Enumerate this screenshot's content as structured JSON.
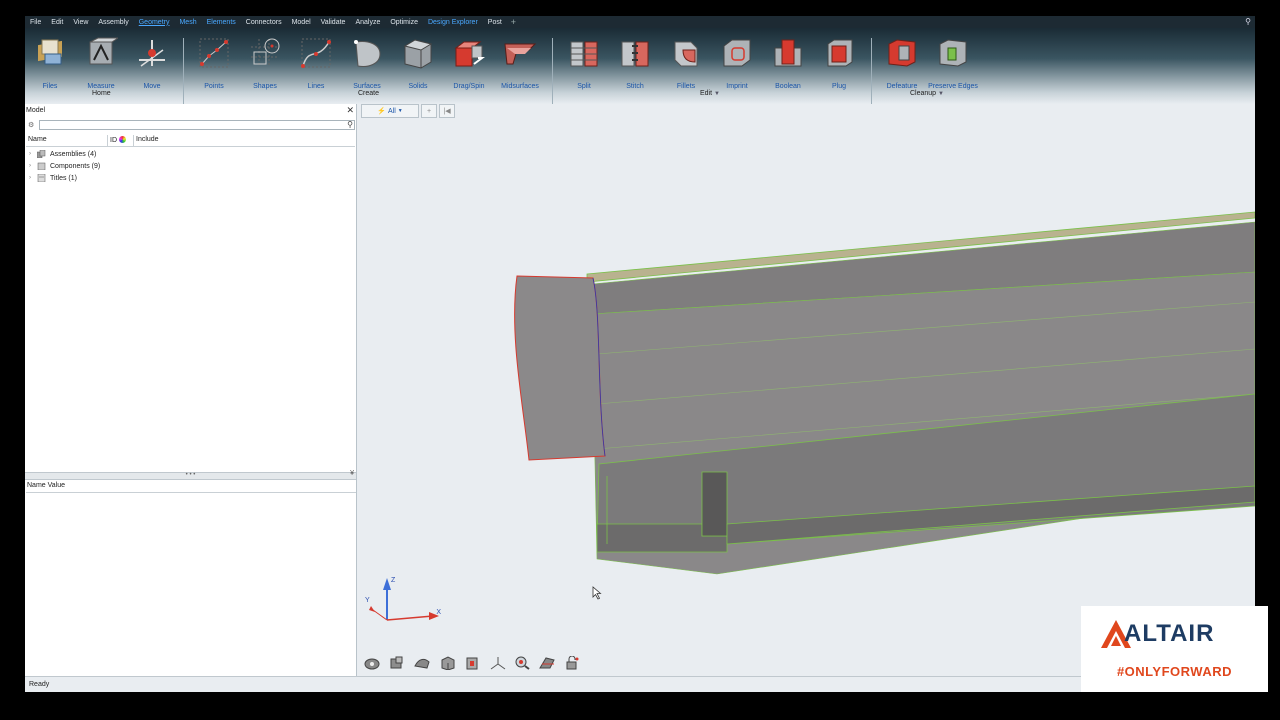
{
  "menubar": {
    "items": [
      {
        "label": "File",
        "state": "normal"
      },
      {
        "label": "Edit",
        "state": "normal"
      },
      {
        "label": "View",
        "state": "normal"
      },
      {
        "label": "Assembly",
        "state": "normal"
      },
      {
        "label": "Geometry",
        "state": "active"
      },
      {
        "label": "Mesh",
        "state": "accent"
      },
      {
        "label": "Elements",
        "state": "accent"
      },
      {
        "label": "Connectors",
        "state": "normal"
      },
      {
        "label": "Model",
        "state": "normal"
      },
      {
        "label": "Validate",
        "state": "normal"
      },
      {
        "label": "Analyze",
        "state": "normal"
      },
      {
        "label": "Optimize",
        "state": "normal"
      },
      {
        "label": "Design Explorer",
        "state": "accent"
      },
      {
        "label": "Post",
        "state": "normal"
      }
    ],
    "plus": "+",
    "search_icon": "search-icon"
  },
  "ribbon": {
    "tools": [
      {
        "label": "Files",
        "icon": "files-icon"
      },
      {
        "label": "Measure",
        "icon": "measure-icon"
      },
      {
        "label": "Move",
        "icon": "move-icon"
      },
      {
        "label": "Points",
        "icon": "points-icon"
      },
      {
        "label": "Shapes",
        "icon": "shapes-icon"
      },
      {
        "label": "Lines",
        "icon": "lines-icon"
      },
      {
        "label": "Surfaces",
        "icon": "surfaces-icon"
      },
      {
        "label": "Solids",
        "icon": "solids-icon"
      },
      {
        "label": "Drag/Spin",
        "icon": "drag-spin-icon"
      },
      {
        "label": "Midsurfaces",
        "icon": "midsurfaces-icon"
      },
      {
        "label": "Split",
        "icon": "split-icon"
      },
      {
        "label": "Stitch",
        "icon": "stitch-icon"
      },
      {
        "label": "Fillets",
        "icon": "fillets-icon"
      },
      {
        "label": "Imprint",
        "icon": "imprint-icon"
      },
      {
        "label": "Boolean",
        "icon": "boolean-icon"
      },
      {
        "label": "Plug",
        "icon": "plug-icon"
      },
      {
        "label": "Defeature",
        "icon": "defeature-icon"
      },
      {
        "label": "Preserve Edges",
        "icon": "preserve-edges-icon"
      }
    ],
    "groups": {
      "home": "Home",
      "create": "Create",
      "edit": "Edit",
      "cleanup": "Cleanup"
    },
    "caret": "▼"
  },
  "model_browser": {
    "title": "Model",
    "close": "✕",
    "search_placeholder": "",
    "columns": {
      "name": "Name",
      "id": "ID",
      "include": "Include"
    },
    "items": [
      {
        "label": "Assemblies (4)"
      },
      {
        "label": "Components (9)"
      },
      {
        "label": "Titles (1)"
      }
    ],
    "splitter": "• • •",
    "splitter_close": "¥"
  },
  "properties": {
    "header": "Name Value"
  },
  "viewport": {
    "filter_label": "All",
    "triad": {
      "x": "X",
      "y": "Y",
      "z": "Z"
    }
  },
  "status": {
    "text": "Ready"
  },
  "branding": {
    "name": "ALTAIR",
    "tagline": "#ONLYFORWARD",
    "colors": {
      "navy": "#1e3c63",
      "orange": "#e0471d"
    }
  },
  "colors": {
    "accent": "#4aa8ff",
    "ribbon_label": "#1b55a8",
    "surface_edge_red": "#d63a2f",
    "surface_edge_green": "#7bc04a",
    "geometry_gray": "#8a8889"
  }
}
